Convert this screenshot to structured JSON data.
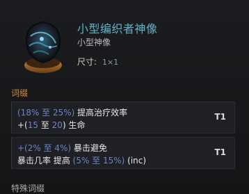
{
  "item": {
    "title": "小型编织者神像",
    "subtitle": "小型神像",
    "size_label": "尺寸:",
    "size_value": "1×1"
  },
  "affix_heading": "词缀",
  "affixes": [
    {
      "line1": {
        "pre": "(18% ",
        "to": "至",
        "range_end": " 25%)",
        "text": " 提高治疗效率"
      },
      "line2": {
        "pre": "+(",
        "low": "15",
        "to": " 至 ",
        "high": "20",
        "close": ")",
        "text": " 生命"
      },
      "tier": "T1"
    },
    {
      "line1": {
        "pre": "+(2% ",
        "to": "至",
        "range_end": " 4%)",
        "text": " 暴击避免"
      },
      "line2": {
        "pre": "暴击几率 提高 ",
        "range": "(5% 至 15%)",
        "text": " (inc)"
      },
      "tier": "T1"
    }
  ],
  "bottom_heading": "特殊词缀",
  "colors": {
    "title": "#5fb4c6",
    "heading": "#d08b3e",
    "range": "#6c84c8",
    "background": "#141517"
  },
  "icons": {
    "item": "idol-icon"
  }
}
